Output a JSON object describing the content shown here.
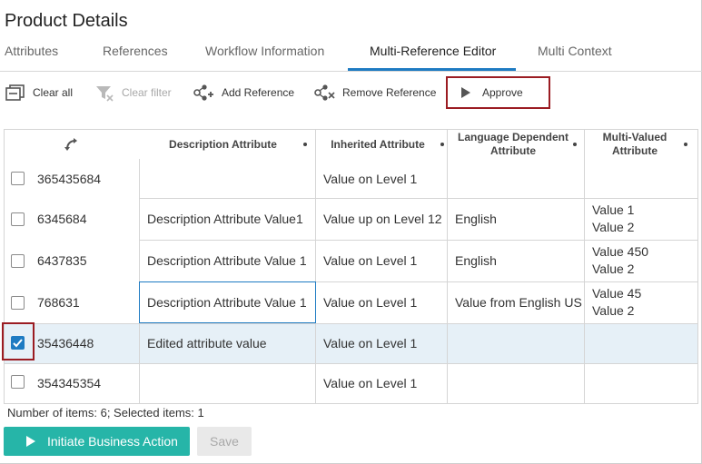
{
  "page": {
    "title": "Product Details"
  },
  "tabs": [
    {
      "label": "Attributes"
    },
    {
      "label": "References"
    },
    {
      "label": "Workflow Information"
    },
    {
      "label": "Multi-Reference Editor",
      "active": true
    },
    {
      "label": "Multi Context"
    }
  ],
  "toolbar": {
    "clear_all": "Clear all",
    "clear_filter": "Clear filter",
    "add_reference": "Add Reference",
    "remove_reference": "Remove Reference",
    "approve": "Approve"
  },
  "table": {
    "columns": [
      {
        "label": ""
      },
      {
        "label": "Description Attribute"
      },
      {
        "label": "Inherited Attribute"
      },
      {
        "label": "Language Dependent Attribute"
      },
      {
        "label": "Multi-Valued Attribute"
      }
    ],
    "rows": [
      {
        "id": "365435684",
        "checked": false,
        "description": "",
        "inherited": "Value on Level 1",
        "language": "",
        "multi": []
      },
      {
        "id": "6345684",
        "checked": false,
        "description": "Description Attribute Value1",
        "inherited": "Value up on Level 12",
        "language": "English",
        "multi": [
          "Value 1",
          "Value 2"
        ]
      },
      {
        "id": "6437835",
        "checked": false,
        "description": "Description Attribute Value 1",
        "inherited": "Value on Level 1",
        "language": "English",
        "multi": [
          "Value 450",
          "Value 2"
        ]
      },
      {
        "id": "768631",
        "checked": false,
        "description": "Description Attribute Value 1",
        "inherited": "Value on Level 1",
        "language": "Value from English US",
        "multi": [
          "Value 45",
          "Value 2"
        ]
      },
      {
        "id": "35436448",
        "checked": true,
        "description": "Edited attribute value",
        "inherited": "Value on Level 1",
        "language": "",
        "multi": []
      },
      {
        "id": "354345354",
        "checked": false,
        "description": "",
        "inherited": "Value on Level 1",
        "language": "",
        "multi": []
      }
    ]
  },
  "status": {
    "text": "Number of items: 6; Selected items: 1"
  },
  "footer": {
    "initiate_label": "Initiate Business Action",
    "save_label": "Save"
  },
  "colors": {
    "accent": "#1e7bc2",
    "primary_button": "#26b5a8",
    "highlight_box": "#9b1c22",
    "selected_row": "#e6f0f7"
  },
  "icons": {
    "clear_all": "clear-all-icon",
    "clear_filter": "filter-icon",
    "add_reference": "add-reference-icon",
    "remove_reference": "remove-reference-icon",
    "approve": "play-icon",
    "sort": "sort-arrows-icon"
  }
}
